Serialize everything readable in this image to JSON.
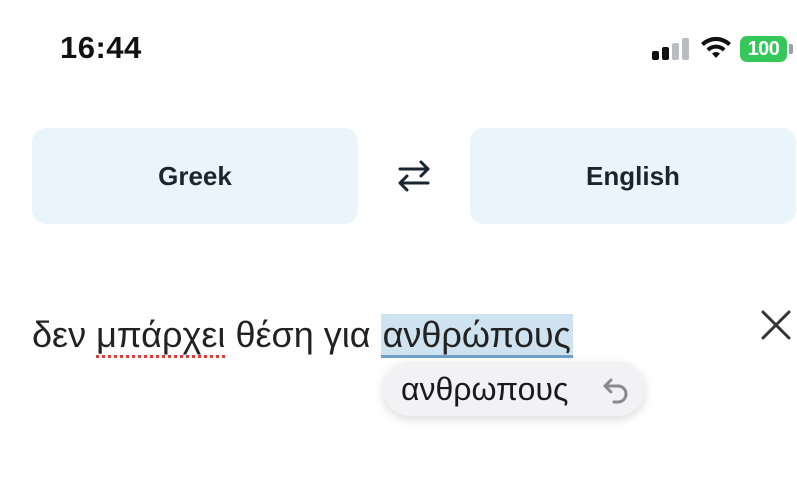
{
  "status_bar": {
    "time": "16:44",
    "battery": "100",
    "battery_color": "#34c759"
  },
  "languages": {
    "source": "Greek",
    "target": "English"
  },
  "input": {
    "word_1": "δεν",
    "word_2": "μπάρχει",
    "word_3": "θέση",
    "word_4": "για",
    "selected_word": "ανθρώπους"
  },
  "suggestion": {
    "text": "ανθρωπους",
    "icon": "undo-icon"
  },
  "colors": {
    "lang_button_bg": "#e9f5fb",
    "selection_bg": "#cfe2ef",
    "spellcheck_underline": "#e53935"
  }
}
